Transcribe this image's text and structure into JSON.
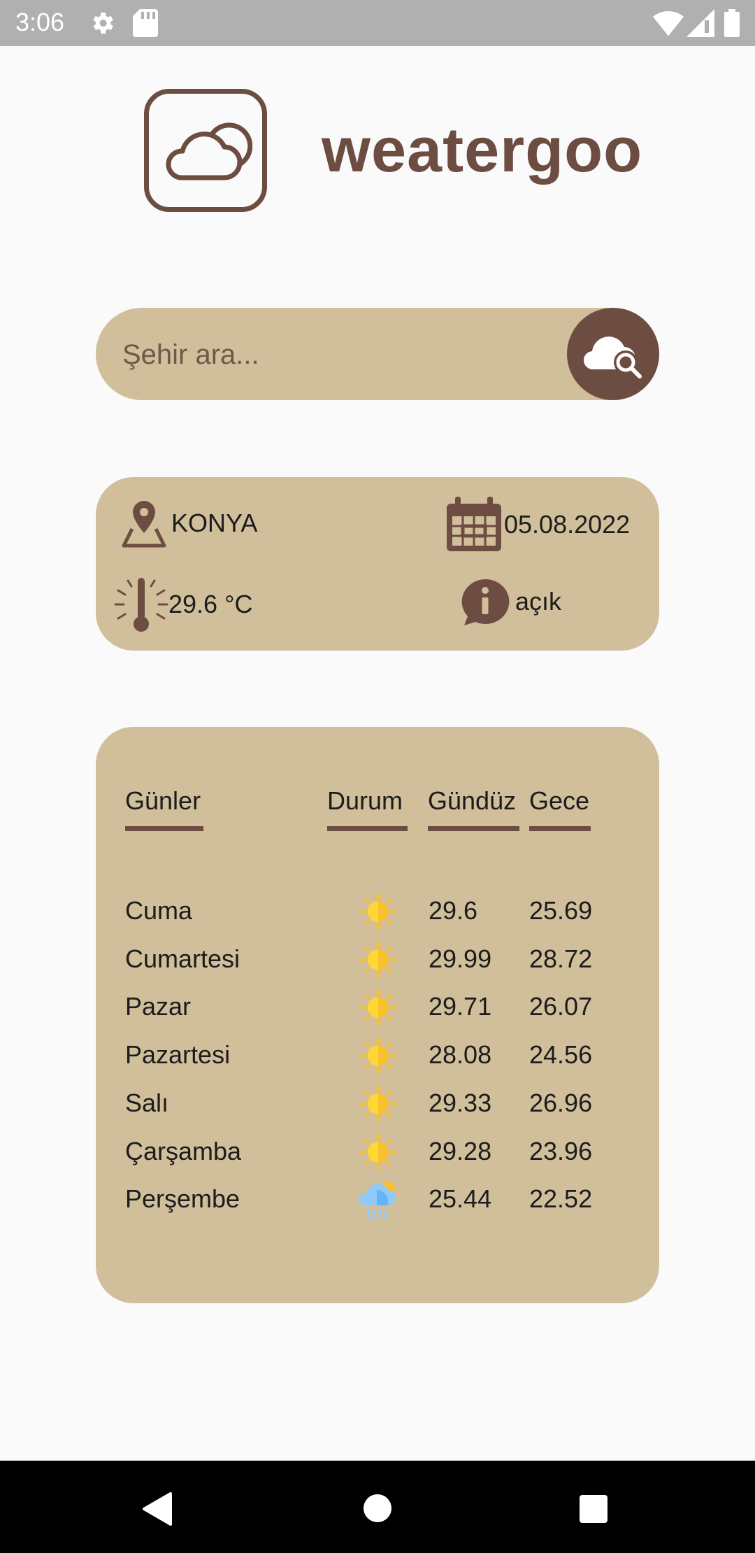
{
  "status_bar": {
    "time": "3:06"
  },
  "app": {
    "title": "weatergoo"
  },
  "search": {
    "placeholder": "Şehir ara...",
    "value": ""
  },
  "current": {
    "city": "KONYA",
    "date": "05.08.2022",
    "temperature": "29.6  °C",
    "description": "açık"
  },
  "forecast": {
    "headers": {
      "days": "Günler",
      "status": "Durum",
      "day": "Gündüz",
      "night": "Gece"
    },
    "rows": [
      {
        "day": "Cuma",
        "icon": "sun-icon",
        "day_temp": "29.6",
        "night_temp": "25.69"
      },
      {
        "day": "Cumartesi",
        "icon": "sun-icon",
        "day_temp": "29.99",
        "night_temp": "28.72"
      },
      {
        "day": "Pazar",
        "icon": "sun-icon",
        "day_temp": "29.71",
        "night_temp": "26.07"
      },
      {
        "day": "Pazartesi",
        "icon": "sun-icon",
        "day_temp": "28.08",
        "night_temp": "24.56"
      },
      {
        "day": "Salı",
        "icon": "sun-icon",
        "day_temp": "29.33",
        "night_temp": "26.96"
      },
      {
        "day": "Çarşamba",
        "icon": "sun-icon",
        "day_temp": "29.28",
        "night_temp": "23.96"
      },
      {
        "day": "Perşembe",
        "icon": "rain-cloud-icon",
        "day_temp": "25.44",
        "night_temp": "22.52"
      }
    ]
  },
  "colors": {
    "accent": "#6d4c41",
    "card": "#d0bf9a",
    "background": "#fafafa",
    "status_bar": "#b0b0b0"
  }
}
